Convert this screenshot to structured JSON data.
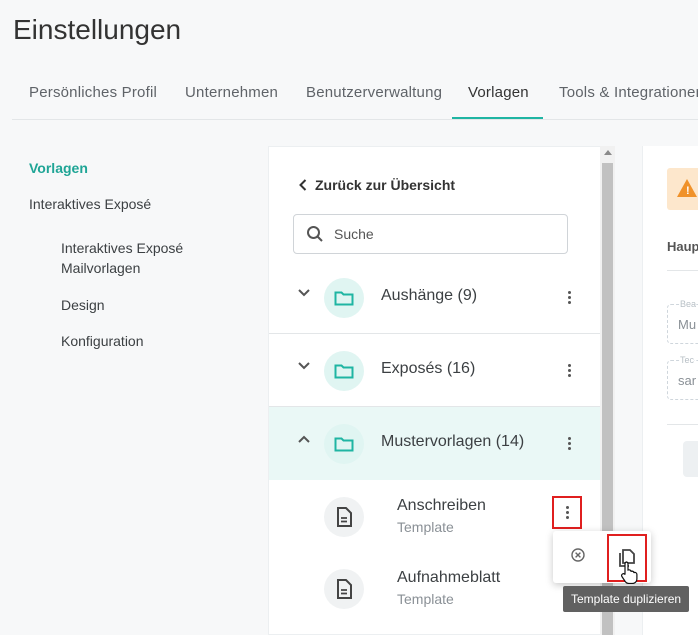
{
  "page": {
    "title": "Einstellungen"
  },
  "tabs": [
    {
      "label": "Persönliches Profil"
    },
    {
      "label": "Unternehmen"
    },
    {
      "label": "Benutzerverwaltung"
    },
    {
      "label": "Vorlagen",
      "active": true
    },
    {
      "label": "Tools & Integrationen"
    }
  ],
  "sidebar": {
    "items": [
      {
        "label": "Vorlagen",
        "active": true
      },
      {
        "label": "Interaktives Exposé"
      }
    ],
    "subitems": [
      {
        "label": "Interaktives Exposé Mailvorlagen"
      },
      {
        "label": "Design"
      },
      {
        "label": "Konfiguration"
      }
    ]
  },
  "templates_panel": {
    "back_label": "Zurück zur Übersicht",
    "search_placeholder": "Suche",
    "folders": [
      {
        "label": "Aushänge (9)",
        "expanded": false
      },
      {
        "label": "Exposés (16)",
        "expanded": false
      },
      {
        "label": "Mustervorlagen (14)",
        "expanded": true
      }
    ],
    "templates": [
      {
        "name": "Anschreiben",
        "type": "Template"
      },
      {
        "name": "Aufnahmeblatt",
        "type": "Template"
      }
    ]
  },
  "context_menu": {
    "tooltip": "Template duplizieren"
  },
  "right_panel": {
    "heading": "Haup",
    "fields": [
      {
        "label": "Bea",
        "value": "Mu"
      },
      {
        "label": "Tec",
        "value": "sar"
      }
    ]
  },
  "colors": {
    "accent": "#1fb5a3",
    "highlight_row": "#eaf8f6",
    "warning": "#f0922a",
    "annotation_red": "#e01f1f"
  }
}
